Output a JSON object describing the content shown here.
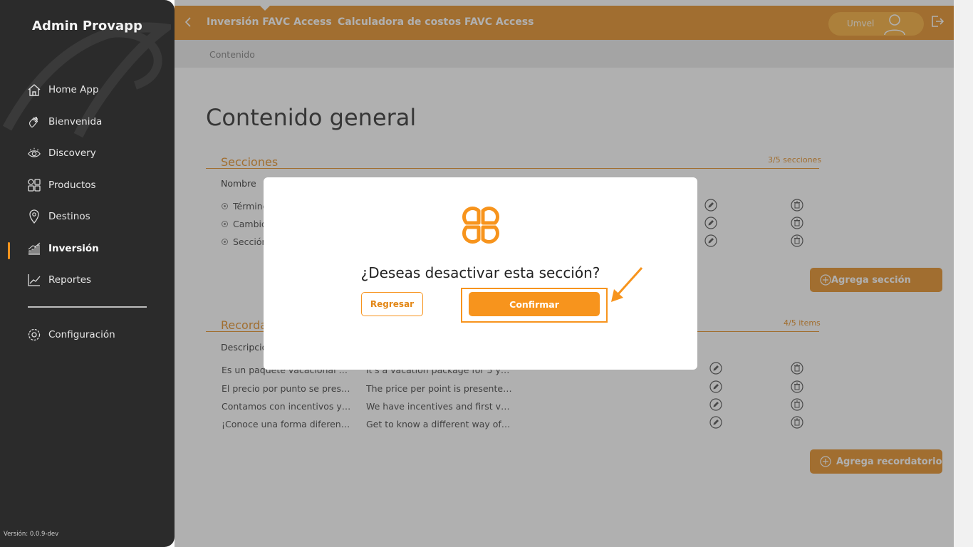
{
  "sidebar": {
    "brand": "Admin Provapp",
    "items": [
      {
        "label": "Home App",
        "icon": "home-icon"
      },
      {
        "label": "Bienvenida",
        "icon": "wave-hand-icon"
      },
      {
        "label": "Discovery",
        "icon": "eye-icon"
      },
      {
        "label": "Productos",
        "icon": "grid-icon"
      },
      {
        "label": "Destinos",
        "icon": "location-pin-icon"
      },
      {
        "label": "Inversión",
        "icon": "bar-chart-icon",
        "active": true
      },
      {
        "label": "Reportes",
        "icon": "line-chart-icon"
      }
    ],
    "settings": {
      "label": "Configuración",
      "icon": "gear-icon"
    },
    "version": "Versión: 0.0.9-dev"
  },
  "topbar": {
    "title": "Inversión FAVC Access",
    "subtitle": "Calculadora de costos FAVC Access",
    "user": "Umvel"
  },
  "breadcrumb": "Contenido",
  "page_title": "Contenido general",
  "sections": {
    "title": "Secciones",
    "count": "3/5 secciones",
    "column": "Nombre",
    "rows": [
      "Términos",
      "Cambio",
      "Sección"
    ],
    "add_label": "Agrega sección"
  },
  "reminders": {
    "title": "Recordatorios",
    "count": "4/5 items",
    "column": "Descripción",
    "rows": [
      {
        "es": "Es un paquete vacacional por…",
        "en": "It's a vacation package for 5 years."
      },
      {
        "es": "El precio por punto se presen…",
        "en": "The price per point is presented i…"
      },
      {
        "es": "Contamos con incentivos y fa…",
        "en": "We have incentives and first visit …"
      },
      {
        "es": "¡Conoce una forma diferente …",
        "en": "Get to know a different way of tra…"
      }
    ],
    "add_label": "Agrega recordatorio"
  },
  "modal": {
    "question": "¿Deseas desactivar esta sección?",
    "back_label": "Regresar",
    "confirm_label": "Confirmar"
  },
  "colors": {
    "accent": "#f7941d",
    "topbar": "#e38716",
    "sidebar": "#2b2b2b"
  }
}
